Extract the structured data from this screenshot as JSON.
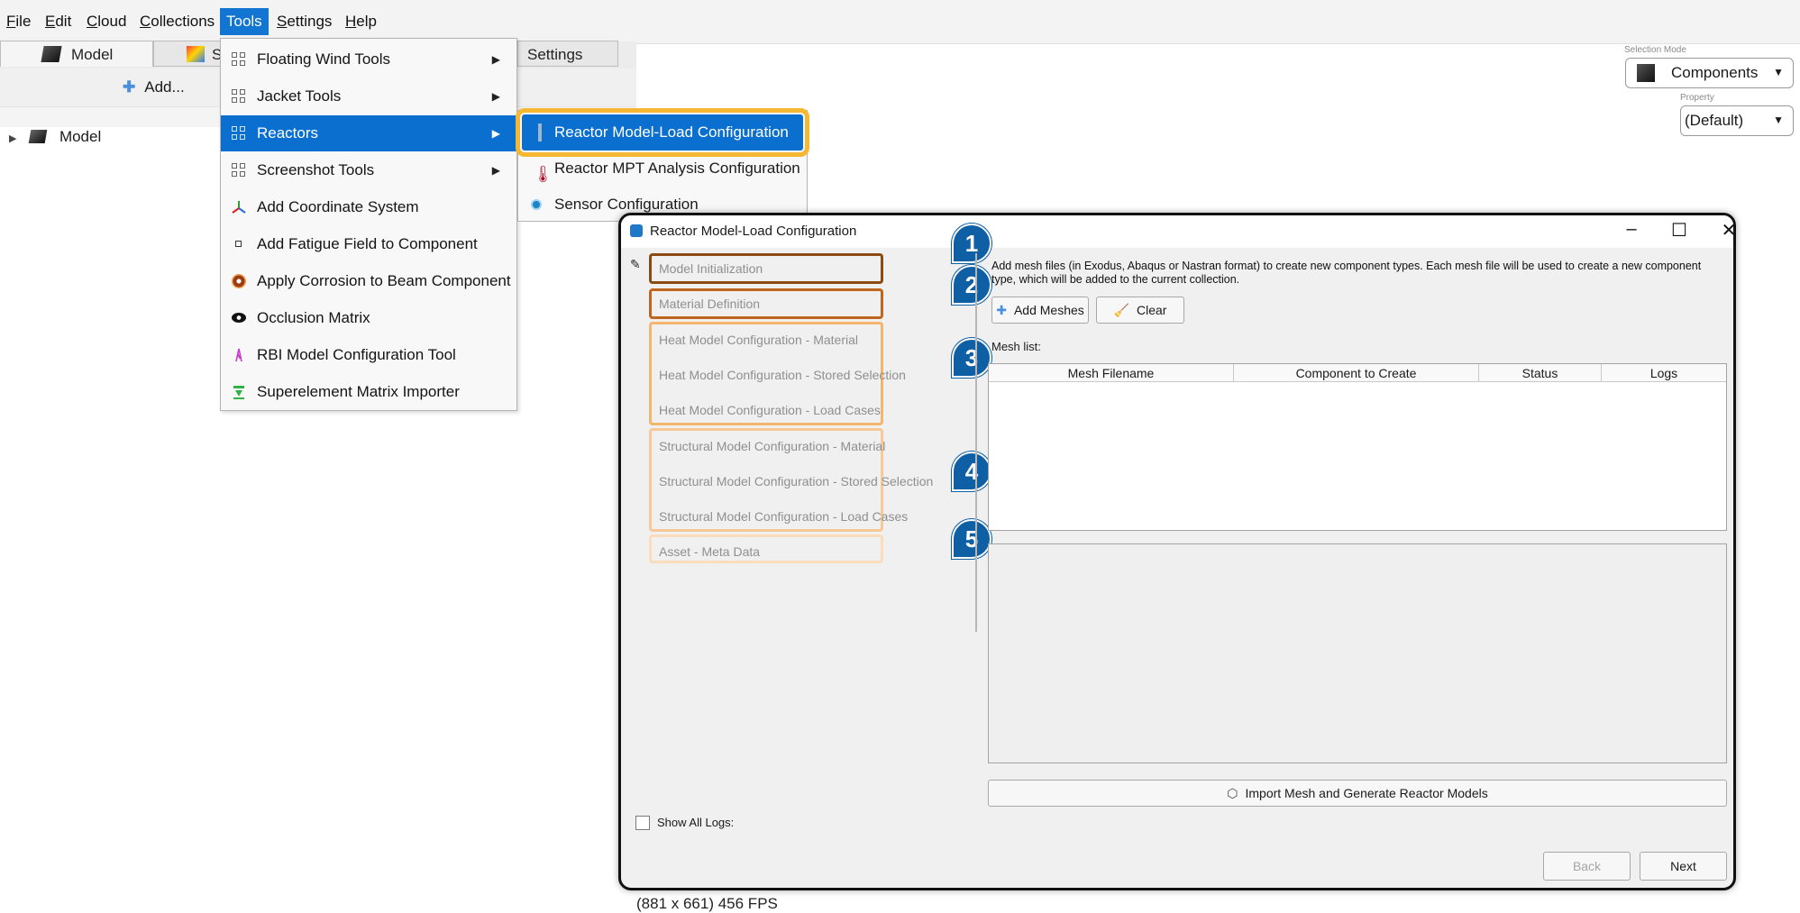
{
  "menubar": {
    "items": [
      {
        "accel": "F",
        "rest": "ile"
      },
      {
        "accel": "E",
        "rest": "dit"
      },
      {
        "accel": "C",
        "rest": "loud"
      },
      {
        "accel": "C",
        "rest": "ollections"
      },
      {
        "accel": "",
        "rest": "Tools"
      },
      {
        "accel": "S",
        "rest": "ettings"
      },
      {
        "accel": "H",
        "rest": "elp"
      }
    ]
  },
  "tabs": {
    "model": "Model",
    "partial": "S",
    "settings": "Settings"
  },
  "toolbar": {
    "add_label": "Add..."
  },
  "tree": {
    "root": "Model"
  },
  "selection": {
    "mode_label": "Selection Mode",
    "mode_value": "Components",
    "property_label": "Property",
    "property_value": "(Default)"
  },
  "tools_menu": {
    "items": [
      "Floating Wind Tools",
      "Jacket Tools",
      "Reactors",
      "Screenshot Tools",
      "Add Coordinate System",
      "Add Fatigue Field to Component",
      "Apply Corrosion to Beam Component",
      "Occlusion Matrix",
      "RBI Model Configuration Tool",
      "Superelement Matrix Importer"
    ]
  },
  "reactors_submenu": {
    "items": [
      "Reactor Model-Load Configuration",
      "Reactor MPT Analysis Configuration",
      "Sensor Configuration"
    ]
  },
  "dialog": {
    "title": "Reactor Model-Load Configuration",
    "steps": [
      "Model Initialization",
      "Material Definition",
      "Heat Model Configuration - Material",
      "Heat Model Configuration - Stored Selection",
      "Heat Model Configuration - Load Cases",
      "Structural Model Configuration - Material",
      "Structural Model Configuration - Stored Selection",
      "Structural Model Configuration - Load Cases",
      "Asset - Meta Data"
    ],
    "badges": [
      "1",
      "2",
      "3",
      "4",
      "5"
    ],
    "description": "Add mesh files (in Exodus, Abaqus or Nastran format) to create new component types. Each mesh file will be used to create a new component type, which will be added to the current collection.",
    "add_meshes": "Add Meshes",
    "clear": "Clear",
    "mesh_list_label": "Mesh list:",
    "columns": [
      "Mesh Filename",
      "Component to Create",
      "Status",
      "Logs"
    ],
    "import_button": "Import Mesh and Generate Reactor Models",
    "show_all_logs": "Show All Logs:",
    "back": "Back",
    "next": "Next"
  },
  "status": {
    "fps": "(881 x 661) 456 FPS"
  },
  "colors": {
    "highlight_blue": "#0b6fd0",
    "callout_orange": "#f6b833",
    "badge_blue": "#0f5fa5",
    "box_brown": "#8b4a12",
    "box_orange": "#f4b56e"
  }
}
